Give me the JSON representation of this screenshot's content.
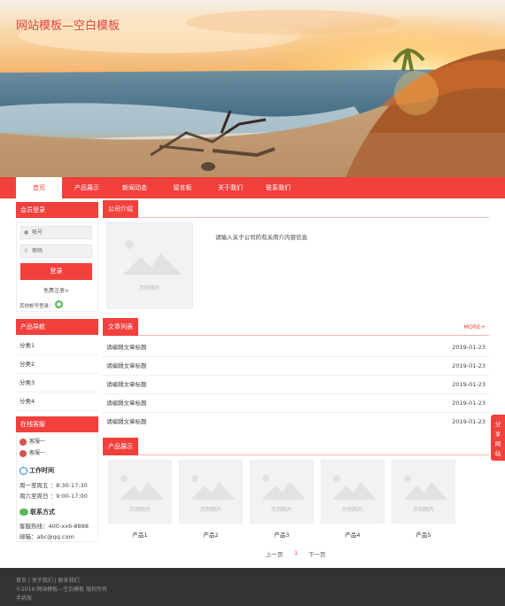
{
  "site_title": "网站模板—空白模板",
  "nav": [
    "首页",
    "产品展示",
    "新闻动态",
    "留言板",
    "关于我们",
    "联系我们"
  ],
  "member": {
    "title": "会员登录",
    "account_placeholder": "帐号",
    "password_placeholder": "密码",
    "login": "登录",
    "register": "免费注册>",
    "other_login": "其他帐号登录："
  },
  "product_nav": {
    "title": "产品导航",
    "items": [
      "分类1",
      "分类2",
      "分类3",
      "分类4"
    ]
  },
  "service": {
    "title": "在线客服",
    "agents": [
      "客服一",
      "客服一"
    ],
    "hours_title": "工作时间",
    "hours": [
      "周一至周五 ：8:30-17:30",
      "周六至周日 ：9:00-17:00"
    ],
    "contact_title": "联系方式",
    "contact": [
      "客服热线：400-xx6-8888",
      "邮箱：abc@qq.com"
    ]
  },
  "company": {
    "title": "公司介绍",
    "image_caption": "示例图片",
    "text": "请输入关于公司的有关简介内容信息"
  },
  "articles": {
    "title": "文章列表",
    "more": "MORE+",
    "rows": [
      {
        "title": "请编辑文章标题",
        "date": "2019-01-23"
      },
      {
        "title": "请编辑文章标题",
        "date": "2019-01-23"
      },
      {
        "title": "请编辑文章标题",
        "date": "2019-01-23"
      },
      {
        "title": "请编辑文章标题",
        "date": "2019-01-23"
      },
      {
        "title": "请编辑文章标题",
        "date": "2019-01-23"
      }
    ]
  },
  "products": {
    "title": "产品展示",
    "image_caption": "示例图片",
    "items": [
      "产品1",
      "产品2",
      "产品3",
      "产品4",
      "产品5"
    ]
  },
  "pager": {
    "prev": "上一页",
    "current": "1",
    "next": "下一页"
  },
  "share": [
    "分",
    "享",
    "网",
    "站"
  ],
  "footer": {
    "links": "首页 | 关于我们 | 联系我们",
    "copyright": "©2019 网站模板—空白模板 版权所有",
    "mobile": "手机版"
  },
  "colors": {
    "accent": "#f2403d",
    "footer_bg": "#333333"
  }
}
